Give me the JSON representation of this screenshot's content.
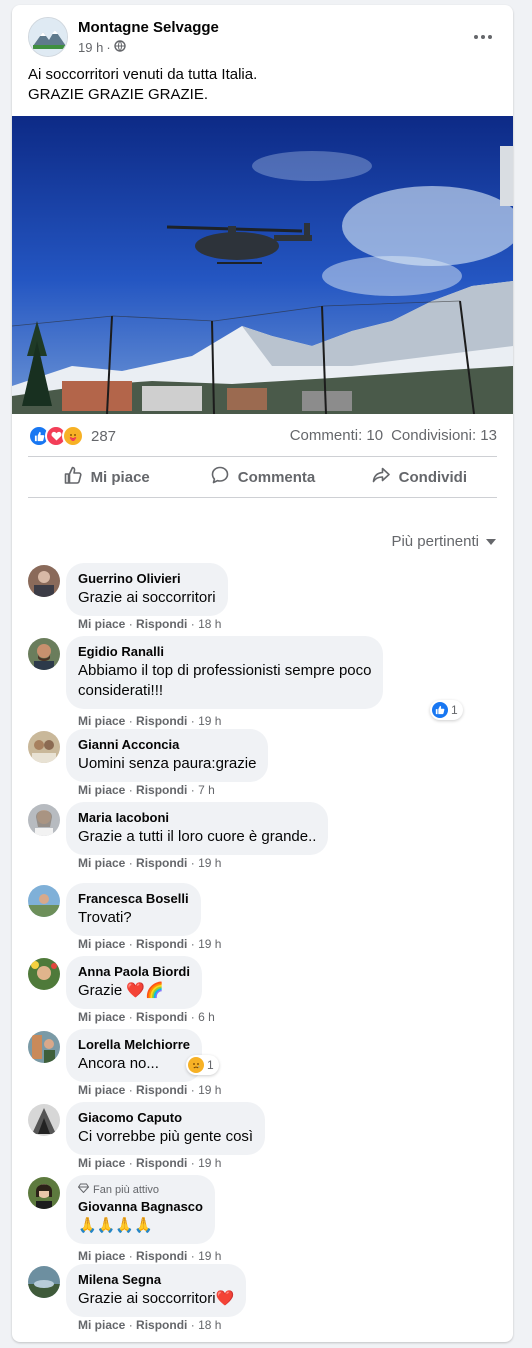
{
  "post": {
    "author": "Montagne Selvagge",
    "time": "19 h",
    "separator": "·",
    "text_lines": [
      "Ai soccorritori venuti da tutta Italia.",
      "GRAZIE GRAZIE GRAZIE."
    ],
    "reaction_count": "287",
    "comments_count": "Commenti: 10",
    "shares_count": "Condivisioni: 13"
  },
  "actions": {
    "like": "Mi piace",
    "comment": "Commenta",
    "share": "Condividi"
  },
  "sort_label": "Più pertinenti",
  "comment_actions": {
    "like": "Mi piace",
    "reply": "Rispondi",
    "dot": "·"
  },
  "comments": [
    {
      "name": "Guerrino Olivieri",
      "text": "Grazie ai soccorritori",
      "time": "18 h"
    },
    {
      "name": "Egidio Ranalli",
      "lines": [
        "Abbiamo il top di professionisti sempre poco",
        "considerati!!!"
      ],
      "time": "19 h",
      "reaction_count": "1"
    },
    {
      "name": "Gianni Acconcia",
      "text": "Uomini senza paura:grazie",
      "time": "7 h"
    },
    {
      "name": "Maria Iacoboni",
      "text": "Grazie a tutti il loro cuore è grande..",
      "time": "19 h"
    },
    {
      "name": "Francesca Boselli",
      "text": "Trovati?",
      "time": "19 h"
    },
    {
      "name": "Anna Paola Biordi",
      "text": "Grazie",
      "emoji": "❤️🌈",
      "time": "6 h"
    },
    {
      "name": "Lorella Melchiorre",
      "text": "Ancora no...",
      "time": "19 h",
      "reaction_count": "1"
    },
    {
      "name": "Giacomo Caputo",
      "text": "Ci vorrebbe più gente così",
      "time": "19 h"
    },
    {
      "name": "Giovanna Bagnasco",
      "badge": "Fan più attivo",
      "text": "🙏🙏🙏🙏",
      "time": "19 h"
    },
    {
      "name": "Milena Segna",
      "text": "Grazie ai soccorritori",
      "emoji": "❤️",
      "time": "18 h"
    }
  ],
  "icons": {
    "more": "more-horizontal-icon",
    "globe": "globe-icon",
    "like": "thumbs-up-icon",
    "comment": "comment-bubble-icon",
    "share": "share-arrow-icon",
    "sort": "caret-down-icon"
  },
  "colors": {
    "like_blue": "#1877f2",
    "love_red": "#f33e58",
    "care_yellow": "#f7b125",
    "muted": "#65676b"
  }
}
